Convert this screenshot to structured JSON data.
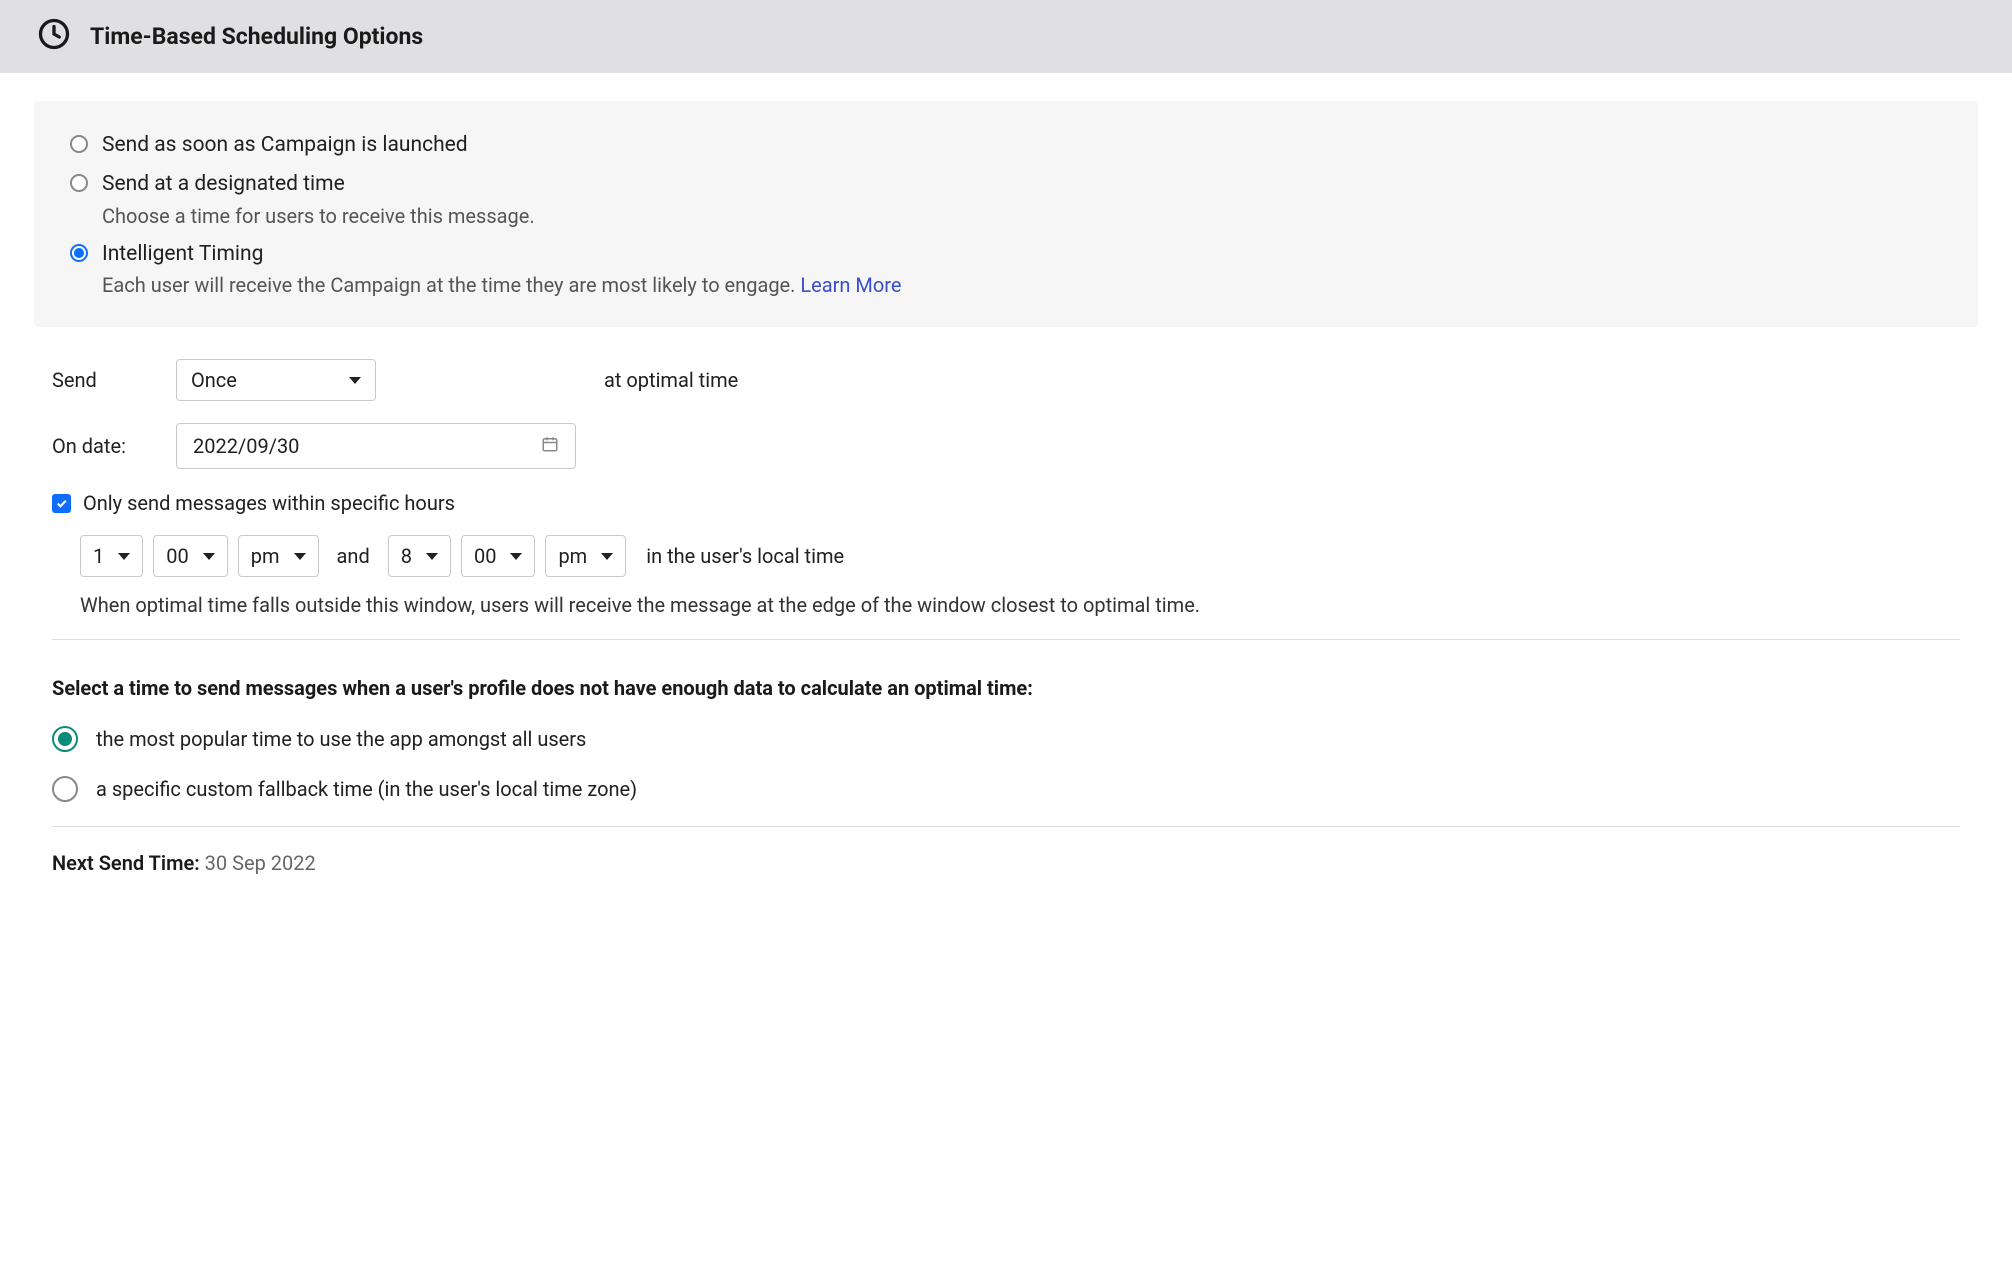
{
  "header": {
    "title": "Time-Based Scheduling Options"
  },
  "timing_options": {
    "opt1": {
      "label": "Send as soon as Campaign is launched"
    },
    "opt2": {
      "label": "Send at a designated time",
      "desc": "Choose a time for users to receive this message."
    },
    "opt3": {
      "label": "Intelligent Timing",
      "desc": "Each user will receive the Campaign at the time they are most likely to engage. ",
      "learn_more": "Learn More"
    }
  },
  "send": {
    "label": "Send",
    "frequency": "Once",
    "suffix": "at optimal time"
  },
  "date": {
    "label": "On date:",
    "value": "2022/09/30"
  },
  "hours": {
    "checkbox_label": "Only send messages within specific hours",
    "start_hour": "1",
    "start_min": "00",
    "start_ampm": "pm",
    "and": "and",
    "end_hour": "8",
    "end_min": "00",
    "end_ampm": "pm",
    "tz_text": "in the user's local time",
    "helper": "When optimal time falls outside this window, users will receive the message at the edge of the window closest to optimal time."
  },
  "fallback": {
    "heading": "Select a time to send messages when a user's profile does not have enough data to calculate an optimal time:",
    "opt1": "the most popular time to use the app amongst all users",
    "opt2": "a specific custom fallback time (in the user's local time zone)"
  },
  "next_send": {
    "label": "Next Send Time: ",
    "value": "30 Sep 2022"
  }
}
